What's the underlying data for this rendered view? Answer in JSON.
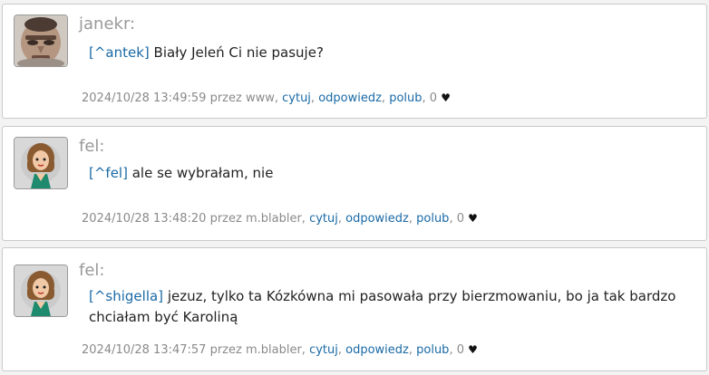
{
  "posts": [
    {
      "author": "janekr:",
      "mention": "[^antek]",
      "text": " Biały Jeleń Ci nie pasuje?",
      "meta": "2024/10/28 13:49:59 przez www,",
      "actions": {
        "quote": "cytuj",
        "reply": "odpowiedz",
        "like": "polub"
      },
      "like_count": "0",
      "avatar_icon": "face-photo-avatar"
    },
    {
      "author": "fel:",
      "mention": "[^fel]",
      "text": " ale se wybrałam, nie",
      "meta": "2024/10/28 13:48:20 przez m.blabler,",
      "actions": {
        "quote": "cytuj",
        "reply": "odpowiedz",
        "like": "polub"
      },
      "like_count": "0",
      "avatar_icon": "cartoon-woman-avatar"
    },
    {
      "author": "fel:",
      "mention": "[^shigella]",
      "text": " jezuz, tylko ta Kózkówna mi pasowała przy bierzmowaniu, bo ja tak bardzo chciałam być Karoliną",
      "meta": "2024/10/28 13:47:57 przez m.blabler,",
      "actions": {
        "quote": "cytuj",
        "reply": "odpowiedz",
        "like": "polub"
      },
      "like_count": "0",
      "avatar_icon": "cartoon-woman-avatar"
    }
  ],
  "heart_glyph": "♥",
  "separator": ", ",
  "colors": {
    "link": "#1a6aa6",
    "author": "#999999",
    "border": "#c9c9c9"
  }
}
